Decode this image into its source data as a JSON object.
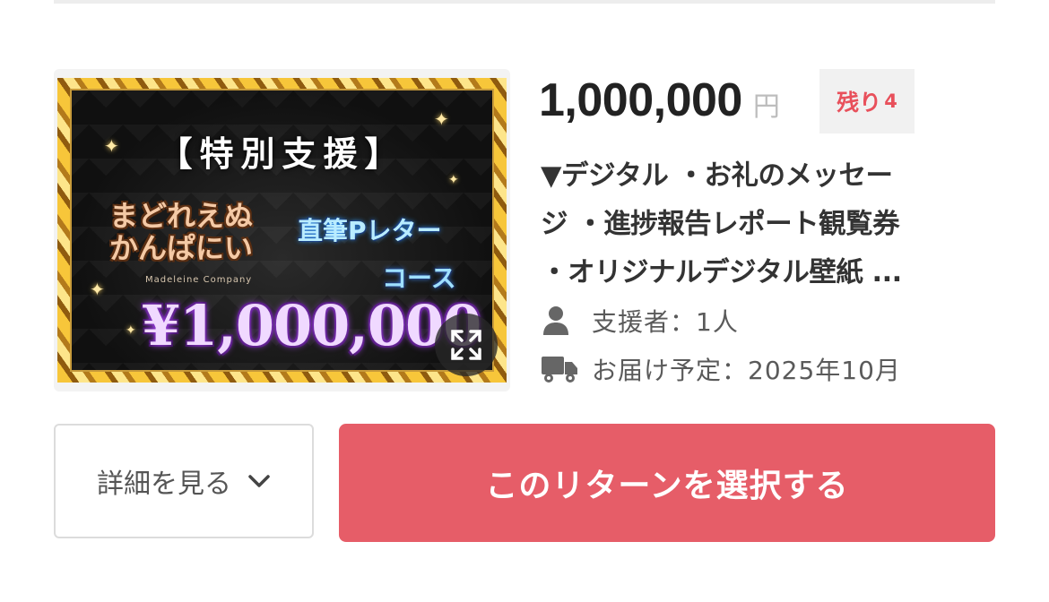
{
  "thumbnail": {
    "tag": "【特別支援】",
    "logo_text": "まどれえぬ かんぱにい",
    "logo_subtext": "Madeleine Company",
    "letter_text": "直筆Pレター",
    "course_text": "コース",
    "price_text": "¥1,000,000",
    "expand_icon": "expand-icon"
  },
  "reward": {
    "price": "1,000,000",
    "currency": "円",
    "remaining_label": "残り",
    "remaining_count": "4",
    "title_lines": [
      "▼デジタル ・お礼のメッセー",
      "ジ ・進捗報告レポート観覧券",
      "・オリジナルデジタル壁紙 ..."
    ],
    "supporters_label": "支援者：1人",
    "delivery_label": "お届け予定：2025年10月"
  },
  "buttons": {
    "details_label": "詳細を見る",
    "select_label": "このリターンを選択する"
  },
  "colors": {
    "accent": "#e65d68",
    "remaining_text": "#e8505b",
    "price_text": "#222222"
  },
  "icons": [
    "person-icon",
    "truck-icon",
    "chevron-down-icon",
    "expand-icon"
  ]
}
